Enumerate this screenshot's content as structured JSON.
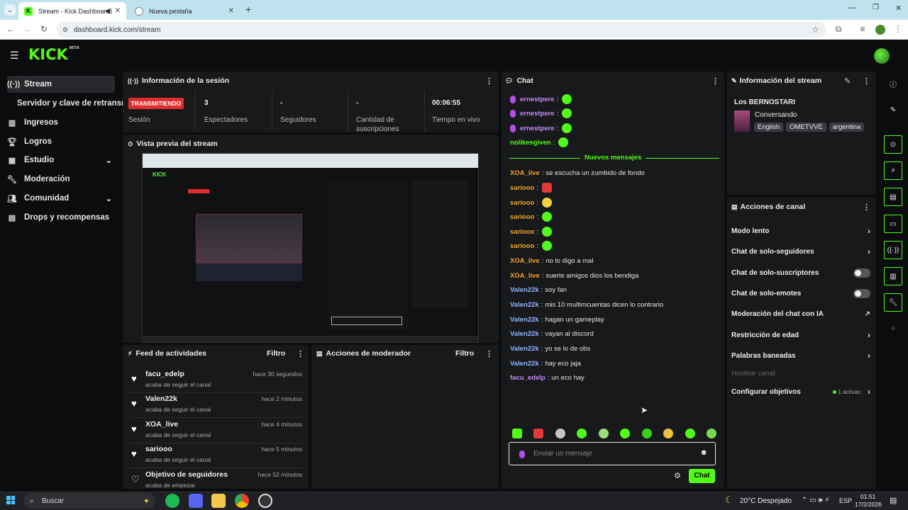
{
  "browser": {
    "tabs": [
      {
        "title": "Stream - Kick Dashboard",
        "active": true
      },
      {
        "title": "Nueva pestaña",
        "active": false
      }
    ],
    "url": "dashboard.kick.com/stream"
  },
  "app": {
    "logo": "KICK",
    "logo_sup": "BETA"
  },
  "sidebar": {
    "items": [
      {
        "label": "Stream",
        "icon": "broadcast-icon"
      },
      {
        "label": "Servidor y clave de retransm"
      },
      {
        "label": "Ingresos",
        "icon": "chart-icon"
      },
      {
        "label": "Logros",
        "icon": "trophy-icon"
      },
      {
        "label": "Estudio",
        "icon": "layout-icon"
      },
      {
        "label": "Moderación",
        "icon": "wrench-icon"
      },
      {
        "label": "Comunidad",
        "icon": "people-icon"
      },
      {
        "label": "Drops y recompensas",
        "icon": "drops-icon"
      }
    ]
  },
  "session": {
    "title": "Información de la sesión",
    "badge": "TRANSMITIENDO",
    "badge_label": "Sesión",
    "stats": [
      {
        "value": "3",
        "label": "Espectadores"
      },
      {
        "value": "-",
        "label": "Seguidores"
      },
      {
        "value": "-",
        "label": "Cantidad de suscripciones"
      },
      {
        "value": "00:06:55",
        "label": "Tiempo en vivo"
      }
    ]
  },
  "preview": {
    "title": "Vista previa del stream"
  },
  "feed": {
    "title": "Feed de actividades",
    "filter": "Filtro",
    "items": [
      {
        "name": "facu_edelp",
        "sub": "acaba de seguir el canal",
        "time": "hace 30 segundos"
      },
      {
        "name": "Valen22k",
        "sub": "acaba de seguir el canal",
        "time": "hace 2 minutos"
      },
      {
        "name": "XOA_live",
        "sub": "acaba de seguir el canal",
        "time": "hace 4 minutos"
      },
      {
        "name": "sariooo",
        "sub": "acaba de seguir el canal",
        "time": "hace 5 minutos"
      },
      {
        "name": "Objetivo de seguidores",
        "sub": "acaba de empezar",
        "time": "hace 52 minutos"
      }
    ]
  },
  "modactions": {
    "title": "Acciones de moderador",
    "filter": "Filtro"
  },
  "chat": {
    "title": "Chat",
    "new_messages": "Nuevos mensajes",
    "old": [
      {
        "user": "ernestpere",
        "text": ""
      },
      {
        "user": "ernestpere",
        "text": ""
      },
      {
        "user": "ernestpere",
        "text": ""
      },
      {
        "user": "nolikesgiven",
        "text": ""
      }
    ],
    "messages": [
      {
        "user": "XOA_live",
        "text": "se escucha un zumbido de fondo",
        "color": "#f5a524"
      },
      {
        "user": "sariooo",
        "text": "",
        "color": "#f5a524"
      },
      {
        "user": "sariooo",
        "text": "",
        "color": "#f5a524"
      },
      {
        "user": "sariooo",
        "text": "",
        "color": "#f5a524"
      },
      {
        "user": "sariooo",
        "text": "",
        "color": "#f5a524"
      },
      {
        "user": "sariooo",
        "text": "",
        "color": "#f5a524"
      },
      {
        "user": "XOA_live",
        "text": "no lo digo a mal",
        "color": "#f5a524"
      },
      {
        "user": "XOA_live",
        "text": "suerte amigos dios los bendiga",
        "color": "#f5a524"
      },
      {
        "user": "Valen22k",
        "text": "soy fan",
        "color": "#8fb7ff"
      },
      {
        "user": "Valen22k",
        "text": "mis 10 multimcuentas dicen lo contrario",
        "color": "#8fb7ff"
      },
      {
        "user": "Valen22k",
        "text": "hagan un gameplay",
        "color": "#8fb7ff"
      },
      {
        "user": "Valen22k",
        "text": "vayan al discord",
        "color": "#8fb7ff"
      },
      {
        "user": "Valen22k",
        "text": "yo se lo de obs",
        "color": "#8fb7ff"
      },
      {
        "user": "Valen22k",
        "text": "hay eco jaja",
        "color": "#8fb7ff"
      },
      {
        "user": "facu_edelp",
        "text": "un eco hay",
        "color": "#c58af9"
      }
    ],
    "placeholder": "Enviar un mensaje",
    "send": "Chat"
  },
  "streaminfo": {
    "title": "Información del stream",
    "stream_title": "Los BERNOSTARI",
    "category": "Conversando",
    "tags": [
      "English",
      "OMETVVE",
      "argentina"
    ]
  },
  "channel": {
    "title": "Acciones de canal",
    "items": [
      {
        "label": "Modo lento",
        "control": "arrow"
      },
      {
        "label": "Chat de solo-seguidores",
        "control": "arrow"
      },
      {
        "label": "Chat de solo-suscriptores",
        "control": "toggle"
      },
      {
        "label": "Chat de solo-emotes",
        "control": "toggle"
      },
      {
        "label": "Moderación del chat con IA",
        "control": "external"
      },
      {
        "label": "Restricción de edad",
        "control": "arrow"
      },
      {
        "label": "Palabras baneadas",
        "control": "arrow"
      },
      {
        "label": "Hostear canal",
        "control": "none"
      },
      {
        "label": "Configurar objetivos",
        "control": "arrow"
      }
    ],
    "objectives_badge": "1 activas"
  },
  "taskbar": {
    "search": "Buscar",
    "weather": "20°C  Despejado",
    "lang": "ESP",
    "time": "01:51",
    "date": "17/2/2026"
  },
  "colors": {
    "brand": "#53fc18",
    "live": "#e02d2d",
    "panel": "#18191b"
  }
}
